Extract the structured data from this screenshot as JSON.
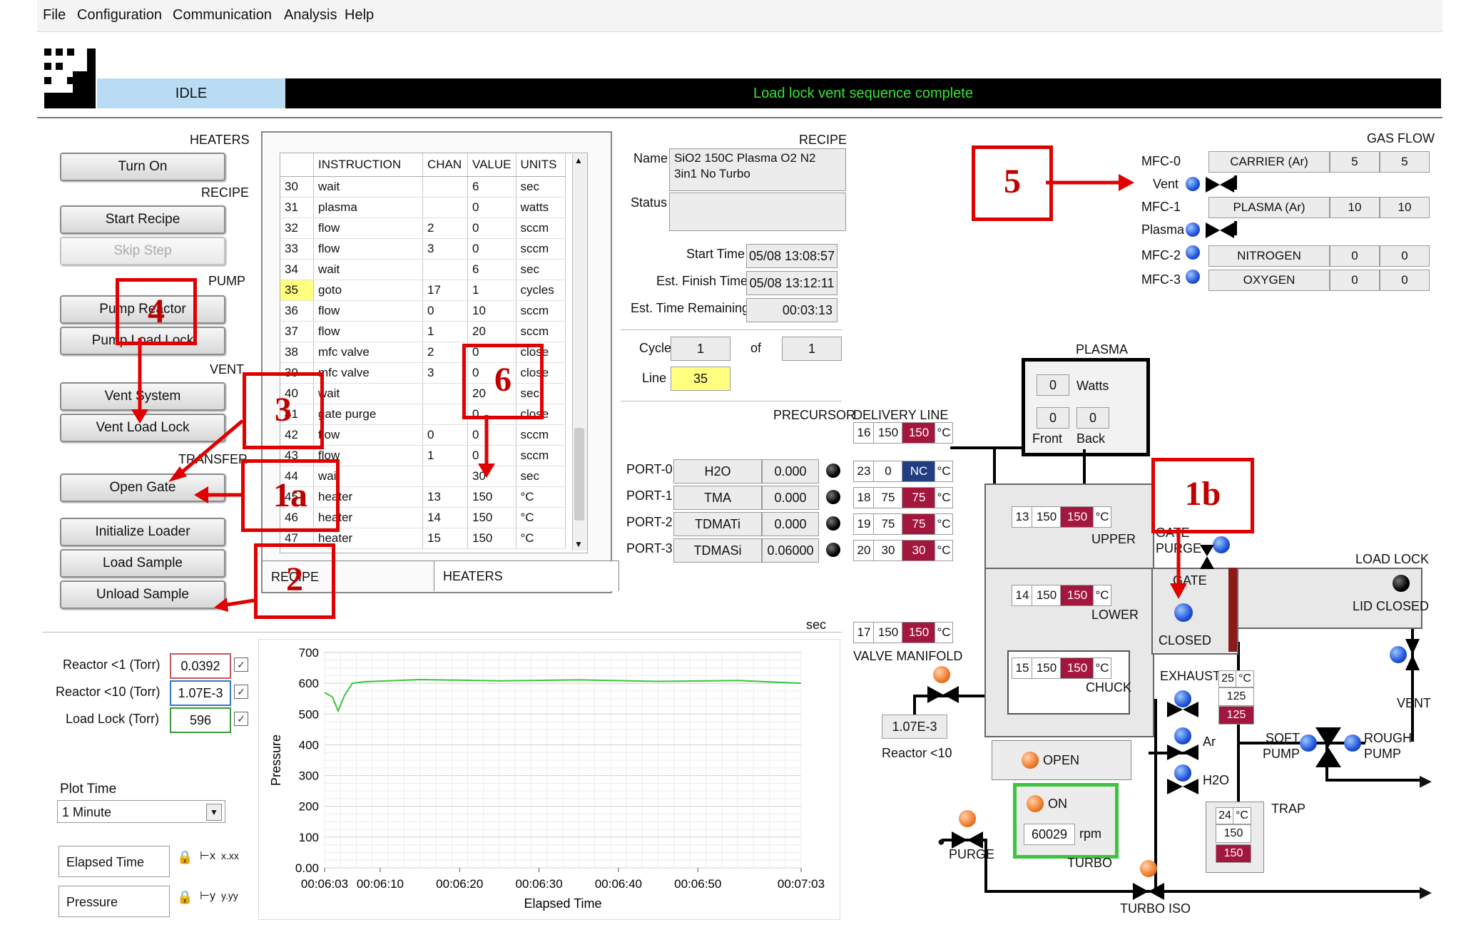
{
  "menu": [
    "File",
    "Configuration",
    "Communication",
    "Analysis",
    "Help"
  ],
  "status": {
    "state": "IDLE",
    "message": "Load lock vent sequence complete"
  },
  "controls": {
    "heaters_label": "HEATERS",
    "turn_on": "Turn On",
    "recipe_label": "RECIPE",
    "start_recipe": "Start Recipe",
    "skip_step": "Skip Step",
    "pump_label": "PUMP",
    "pump_reactor": "Pump Reactor",
    "pump_load_lock": "Pump Load Lock",
    "vent_label": "VENT",
    "vent_system": "Vent System",
    "vent_load_lock": "Vent Load Lock",
    "transfer_label": "TRANSFER",
    "open_gate": "Open Gate",
    "initialize_loader": "Initialize Loader",
    "load_sample": "Load Sample",
    "unload_sample": "Unload Sample"
  },
  "recipe_table": {
    "headers": [
      "INSTRUCTION",
      "CHAN",
      "VALUE",
      "UNITS"
    ],
    "rows": [
      [
        "30",
        "wait",
        "",
        "6",
        "sec"
      ],
      [
        "31",
        "plasma",
        "",
        "0",
        "watts"
      ],
      [
        "32",
        "flow",
        "2",
        "0",
        "sccm"
      ],
      [
        "33",
        "flow",
        "3",
        "0",
        "sccm"
      ],
      [
        "34",
        "wait",
        "",
        "6",
        "sec"
      ],
      [
        "35",
        "goto",
        "17",
        "1",
        "cycles"
      ],
      [
        "36",
        "flow",
        "0",
        "10",
        "sccm"
      ],
      [
        "37",
        "flow",
        "1",
        "20",
        "sccm"
      ],
      [
        "38",
        "mfc valve",
        "2",
        "0",
        "close"
      ],
      [
        "39",
        "mfc valve",
        "3",
        "0",
        "close"
      ],
      [
        "40",
        "wait",
        "",
        "20",
        "sec"
      ],
      [
        "41",
        "gate purge",
        "",
        "0",
        "close"
      ],
      [
        "42",
        "flow",
        "0",
        "0",
        "sccm"
      ],
      [
        "43",
        "flow",
        "1",
        "0",
        "sccm"
      ],
      [
        "44",
        "wait",
        "",
        "30",
        "sec"
      ],
      [
        "45",
        "heater",
        "13",
        "150",
        "°C"
      ],
      [
        "46",
        "heater",
        "14",
        "150",
        "°C"
      ],
      [
        "47",
        "heater",
        "15",
        "150",
        "°C"
      ]
    ],
    "highlight_row": "35",
    "tab_recipe": "RECIPE",
    "tab_heaters": "HEATERS"
  },
  "recipe_info": {
    "label": "RECIPE",
    "name_label": "Name",
    "name": "SiO2 150C Plasma O2 N2\n3in1 No Turbo",
    "status_label": "Status",
    "status": "",
    "start_time_label": "Start Time",
    "start_time": "05/08 13:08:57",
    "est_finish_label": "Est. Finish Time",
    "est_finish": "05/08 13:12:11",
    "est_remaining_label": "Est. Time Remaining",
    "est_remaining": "00:03:13",
    "cycle_label": "Cycle",
    "cycle": "1",
    "of_label": "of",
    "cycle_total": "1",
    "line_label": "Line",
    "line": "35"
  },
  "precursor": {
    "label": "PRECURSOR",
    "delivery_label": "DELIVERY LINE",
    "delivery_top": {
      "ch": "16",
      "set": "150",
      "act": "150",
      "unit": "°C"
    },
    "ports": [
      {
        "port": "PORT-0",
        "name": "H2O",
        "val": "0.000",
        "ch": "23",
        "set": "0",
        "act": "NC",
        "unit": "°C"
      },
      {
        "port": "PORT-1",
        "name": "TMA",
        "val": "0.000",
        "ch": "18",
        "set": "75",
        "act": "75",
        "unit": "°C"
      },
      {
        "port": "PORT-2",
        "name": "TDMATi",
        "val": "0.000",
        "ch": "19",
        "set": "75",
        "act": "75",
        "unit": "°C"
      },
      {
        "port": "PORT-3",
        "name": "TDMASi",
        "val": "0.06000",
        "ch": "20",
        "set": "30",
        "act": "30",
        "unit": "°C"
      }
    ],
    "valve_manifold": {
      "ch": "17",
      "set": "150",
      "act": "150",
      "unit": "°C",
      "label": "VALVE MANIFOLD"
    },
    "sec_label": "sec"
  },
  "plasma": {
    "label": "PLASMA",
    "watts": "0",
    "watts_label": "Watts",
    "front": "0",
    "back": "0",
    "front_label": "Front",
    "back_label": "Back"
  },
  "gas_flow": {
    "label": "GAS FLOW",
    "mfcs": [
      {
        "mfc": "MFC-0",
        "name": "CARRIER (Ar)",
        "set": "5",
        "act": "5"
      },
      {
        "mfc": "MFC-1",
        "name": "PLASMA (Ar)",
        "set": "10",
        "act": "10"
      },
      {
        "mfc": "MFC-2",
        "name": "NITROGEN",
        "set": "0",
        "act": "0"
      },
      {
        "mfc": "MFC-3",
        "name": "OXYGEN",
        "set": "0",
        "act": "0"
      }
    ],
    "vent_label": "Vent",
    "plasma_label": "Plasma"
  },
  "reactor": {
    "upper": {
      "ch": "13",
      "set": "150",
      "act": "150",
      "unit": "°C",
      "label": "UPPER"
    },
    "lower": {
      "ch": "14",
      "set": "150",
      "act": "150",
      "unit": "°C",
      "label": "LOWER"
    },
    "chuck": {
      "ch": "15",
      "set": "150",
      "act": "150",
      "unit": "°C",
      "label": "CHUCK"
    },
    "gate_purge_label": "GATE\nPURGE",
    "gate_label": "GATE",
    "gate_state": "CLOSED",
    "load_lock_label": "LOAD LOCK",
    "lid_label": "LID CLOSED",
    "vent_label": "VENT",
    "exhaust_label": "EXHAUST",
    "exhaust_ch": "25",
    "exhaust_unit": "°C",
    "exhaust_set": "125",
    "exhaust_act": "125",
    "ar_label": "Ar",
    "h2o_label": "H2O",
    "soft_pump": "SOFT\nPUMP",
    "rough_pump": "ROUGH\nPUMP",
    "trap_label": "TRAP",
    "trap_ch": "24",
    "trap_unit": "°C",
    "trap_set": "150",
    "trap_act": "150",
    "open_label": "OPEN",
    "turbo_on": "ON",
    "turbo_rpm": "60029",
    "rpm_label": "rpm",
    "turbo_label": "TURBO",
    "purge_label": "PURGE",
    "turbo_iso": "TURBO ISO",
    "reactor10_val": "1.07E-3",
    "reactor10_label": "Reactor <10"
  },
  "pressures": {
    "reactor1_label": "Reactor <1 (Torr)",
    "reactor1": "0.0392",
    "reactor10_label": "Reactor <10 (Torr)",
    "reactor10": "1.07E-3",
    "loadlock_label": "Load Lock (Torr)",
    "loadlock": "596",
    "plot_time_label": "Plot Time",
    "plot_time": "1 Minute",
    "elapsed_label": "Elapsed Time",
    "pressure_label": "Pressure"
  },
  "annotations": [
    "1a",
    "1b",
    "2",
    "3",
    "4",
    "5",
    "6"
  ],
  "chart_data": {
    "type": "line",
    "xlabel": "Elapsed Time",
    "ylabel": "Pressure",
    "ylim": [
      0,
      700
    ],
    "yticks": [
      "0.00",
      "100",
      "200",
      "300",
      "400",
      "500",
      "600",
      "700"
    ],
    "xticks": [
      "00:06:03",
      "00:06:10",
      "00:06:20",
      "00:06:30",
      "00:06:40",
      "00:06:50",
      "00:07:03"
    ],
    "xtick_secs": [
      363,
      370,
      380,
      390,
      400,
      410,
      423
    ],
    "series": [
      {
        "color": "#3cc43c",
        "x": [
          363,
          364,
          364.7,
          365.5,
          366.5,
          368,
          375,
          385,
          395,
          405,
          415,
          423
        ],
        "y": [
          570,
          555,
          510,
          560,
          600,
          605,
          612,
          608,
          611,
          606,
          609,
          600
        ]
      }
    ],
    "grid": true
  }
}
